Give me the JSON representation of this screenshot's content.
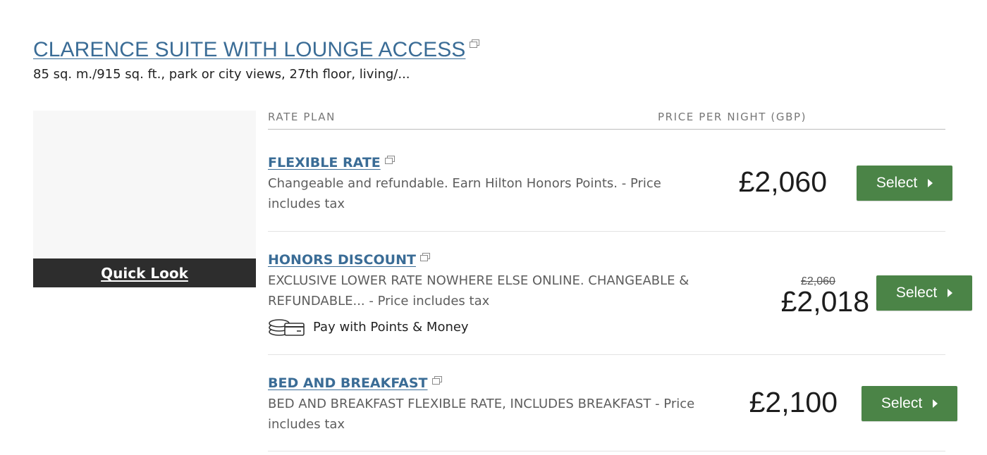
{
  "room": {
    "title": "CLARENCE SUITE WITH LOUNGE ACCESS",
    "description": "85 sq. m./915 sq. ft., park or city views, 27th floor, living/...",
    "quick_look_label": "Quick Look"
  },
  "table": {
    "rate_plan_header": "RATE PLAN",
    "price_header": "PRICE PER NIGHT (GBP)"
  },
  "rates": [
    {
      "name": "FLEXIBLE RATE",
      "description": "Changeable and refundable. Earn Hilton Honors Points. - Price includes tax",
      "price": "£2,060",
      "select_label": "Select"
    },
    {
      "name": "HONORS DISCOUNT",
      "description": "EXCLUSIVE LOWER RATE NOWHERE ELSE ONLINE. CHANGEABLE & REFUNDABLE... - Price includes tax",
      "original_price": "£2,060",
      "price": "£2,018",
      "points_money_label": "Pay with Points & Money",
      "select_label": "Select"
    },
    {
      "name": "BED AND BREAKFAST",
      "description": "BED AND BREAKFAST FLEXIBLE RATE, INCLUDES BREAKFAST - Price includes tax",
      "price": "£2,100",
      "select_label": "Select"
    }
  ],
  "icons": {
    "external": "new-window-icon",
    "points_money": "coins-and-card-icon",
    "caret": "caret-right-icon"
  },
  "colors": {
    "link": "#3a6c96",
    "select_button": "#4b8447",
    "quick_look_bar": "#2d2d2d"
  }
}
